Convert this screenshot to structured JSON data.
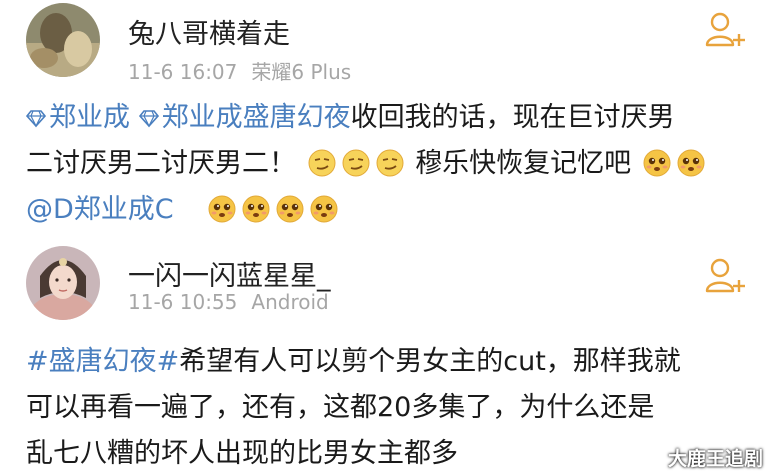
{
  "posts": [
    {
      "username": "兔八哥横着走",
      "time": "11-6 16:07",
      "device": "荣耀6 Plus",
      "line1": {
        "mention1": "郑业成",
        "mention2": "郑业成盛唐幻夜",
        "text": "收回我的话，现在巨讨厌男"
      },
      "line2": {
        "text_a": "二讨厌男二讨厌男二！",
        "text_b": "穆乐快恢复记忆吧"
      },
      "line3": {
        "mention": "@D郑业成C"
      }
    },
    {
      "username": "一闪一闪蓝星星_",
      "time": "11-6 10:55",
      "device": "Android",
      "hashtag": "#盛唐幻夜#",
      "text1": "希望有人可以剪个男女主的cut，那样我就",
      "text2": "可以再看一遍了，还有，这都20多集了，为什么还是",
      "text3": "乱七八糟的坏人出现的比男女主都多"
    }
  ],
  "watermark": "大鹿王追剧",
  "colors": {
    "link": "#4a7fbf",
    "follow": "#e8a33c",
    "meta": "#a6a6a6"
  }
}
